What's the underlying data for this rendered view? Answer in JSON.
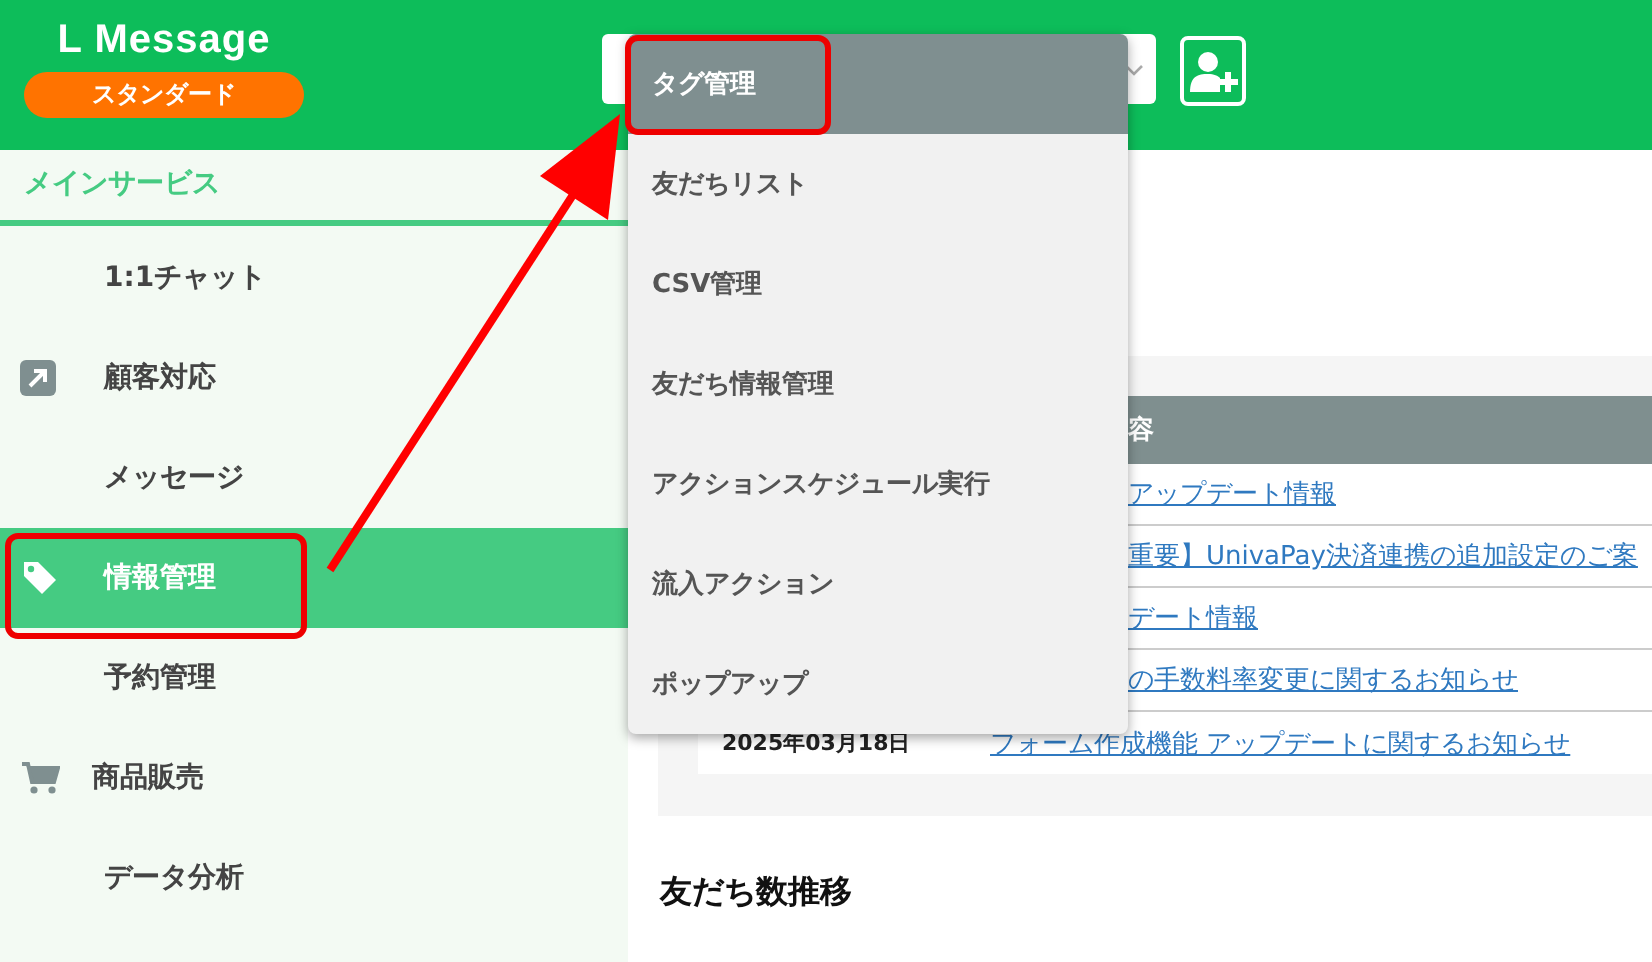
{
  "header": {
    "logo": "L Message",
    "plan_badge": "スタンダード"
  },
  "sidebar": {
    "section_title": "メインサービス",
    "items": [
      {
        "label": "1:1チャット",
        "kind": "plain",
        "selected": false
      },
      {
        "label": "顧客対応",
        "kind": "arrow",
        "selected": false
      },
      {
        "label": "メッセージ",
        "kind": "plain",
        "selected": false
      },
      {
        "label": "情報管理",
        "kind": "tag",
        "selected": true
      },
      {
        "label": "予約管理",
        "kind": "plain",
        "selected": false
      },
      {
        "label": "商品販売",
        "kind": "cart",
        "selected": false
      },
      {
        "label": "データ分析",
        "kind": "plain",
        "selected": false
      }
    ]
  },
  "dropdown": {
    "items": [
      {
        "label": "タグ管理",
        "selected": true
      },
      {
        "label": "友だちリスト",
        "selected": false
      },
      {
        "label": "CSV管理",
        "selected": false
      },
      {
        "label": "友だち情報管理",
        "selected": false
      },
      {
        "label": "アクションスケジュール実行",
        "selected": false
      },
      {
        "label": "流入アクション",
        "selected": false
      },
      {
        "label": "ポップアップ",
        "selected": false
      }
    ]
  },
  "news_table": {
    "columns": [
      "容"
    ],
    "rows": [
      {
        "title": "アップデート情報"
      },
      {
        "title": "重要】UnivaPay決済連携の追加設定のご案"
      },
      {
        "title": "デート情報"
      },
      {
        "title": "の手数料率変更に関するお知らせ"
      },
      {
        "date": "2025年03月18日",
        "title": "フォーム作成機能 アップデートに関するお知らせ"
      }
    ]
  },
  "section_heading": "友だち数推移"
}
